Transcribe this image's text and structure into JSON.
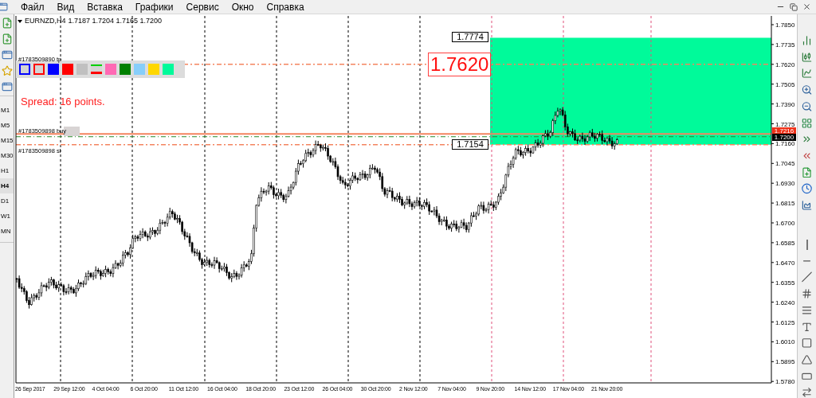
{
  "menu": [
    "Файл",
    "Вид",
    "Вставка",
    "Графики",
    "Сервис",
    "Окно",
    "Справка"
  ],
  "timeframes": [
    {
      "label": "M1",
      "selected": false
    },
    {
      "label": "M5",
      "selected": false
    },
    {
      "label": "M15",
      "selected": false
    },
    {
      "label": "M30",
      "selected": false
    },
    {
      "label": "H1",
      "selected": false
    },
    {
      "label": "H4",
      "selected": true
    },
    {
      "label": "D1",
      "selected": false
    },
    {
      "label": "W1",
      "selected": false
    },
    {
      "label": "MN",
      "selected": false
    }
  ],
  "chart": {
    "symbol": "EURNZD,H4",
    "ohlc": "1.7187 1.7204 1.7165 1.7200",
    "swatches": [
      {
        "kind": "outline",
        "color": "#0000ff"
      },
      {
        "kind": "outline",
        "color": "#ff0000"
      },
      {
        "kind": "fill",
        "color": "#0000ff"
      },
      {
        "kind": "fill",
        "color": "#ff0000"
      },
      {
        "kind": "fill",
        "color": "#c0c0c0"
      },
      {
        "kind": "lines"
      },
      {
        "kind": "fill",
        "color": "#ff69b4"
      },
      {
        "kind": "fill",
        "color": "#008000"
      },
      {
        "kind": "fill",
        "color": "#87cefa"
      },
      {
        "kind": "fill",
        "color": "#ffd700"
      },
      {
        "kind": "fill",
        "color": "#00fa9a"
      }
    ],
    "spread": "Spread: 16 points.",
    "order_lines": [
      {
        "label": "#1783509890 tp",
        "kind": "tp"
      },
      {
        "label": "#1783509898 buy",
        "kind": "buy"
      },
      {
        "label": "#1783509898 sl",
        "kind": "sl"
      }
    ],
    "zone_labels": [
      {
        "text": "1.7774",
        "kind": "small"
      },
      {
        "text": "1.7620",
        "kind": "big"
      },
      {
        "text": "1.7154",
        "kind": "small"
      }
    ],
    "current_prices": [
      {
        "text": "1.7216",
        "kind": "ask"
      },
      {
        "text": "1.7200",
        "kind": "bid"
      }
    ],
    "price_axis": [
      "1.7850",
      "1.7735",
      "1.7620",
      "1.7505",
      "1.7390",
      "1.7275",
      "1.7160",
      "1.7045",
      "1.6930",
      "1.6815",
      "1.6700",
      "1.6585",
      "1.6470",
      "1.6355",
      "1.6240",
      "1.6125",
      "1.6010",
      "1.5895",
      "1.5780"
    ],
    "time_axis": [
      "26 Sep 2017",
      "29 Sep 12:00",
      "4 Oct 04:00",
      "6 Oct 20:00",
      "11 Oct 12:00",
      "16 Oct 04:00",
      "18 Oct 20:00",
      "23 Oct 12:00",
      "26 Oct 04:00",
      "30 Oct 20:00",
      "2 Nov 12:00",
      "7 Nov 04:00",
      "9 Nov 20:00",
      "14 Nov 12:00",
      "17 Nov 04:00",
      "21 Nov 20:00"
    ]
  }
}
